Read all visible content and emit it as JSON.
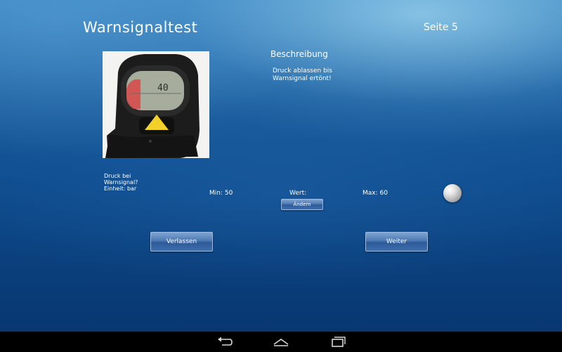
{
  "header": {
    "title": "Warnsignaltest",
    "page": "Seite 5"
  },
  "photo": {
    "display_reading": "40"
  },
  "description": {
    "heading": "Beschreibung",
    "line1": "Druck ablassen bis",
    "line2": "Warnsignal ertönt!"
  },
  "question": {
    "line1": "Druck bei",
    "line2": "Warnsignal?",
    "line3": "Einheit: bar"
  },
  "range": {
    "min_label": "Min: 50",
    "value_label": "Wert:",
    "max_label": "Max: 60"
  },
  "buttons": {
    "change": "Ändern",
    "leave": "Verlassen",
    "next": "Weiter"
  },
  "navbar": {
    "icons": [
      "back-icon",
      "home-icon",
      "recents-icon"
    ]
  },
  "colors": {
    "button_top": "#7fa4d0",
    "button_bottom": "#2d5a98",
    "background": "#0e4c8e",
    "navbar": "#000000"
  }
}
